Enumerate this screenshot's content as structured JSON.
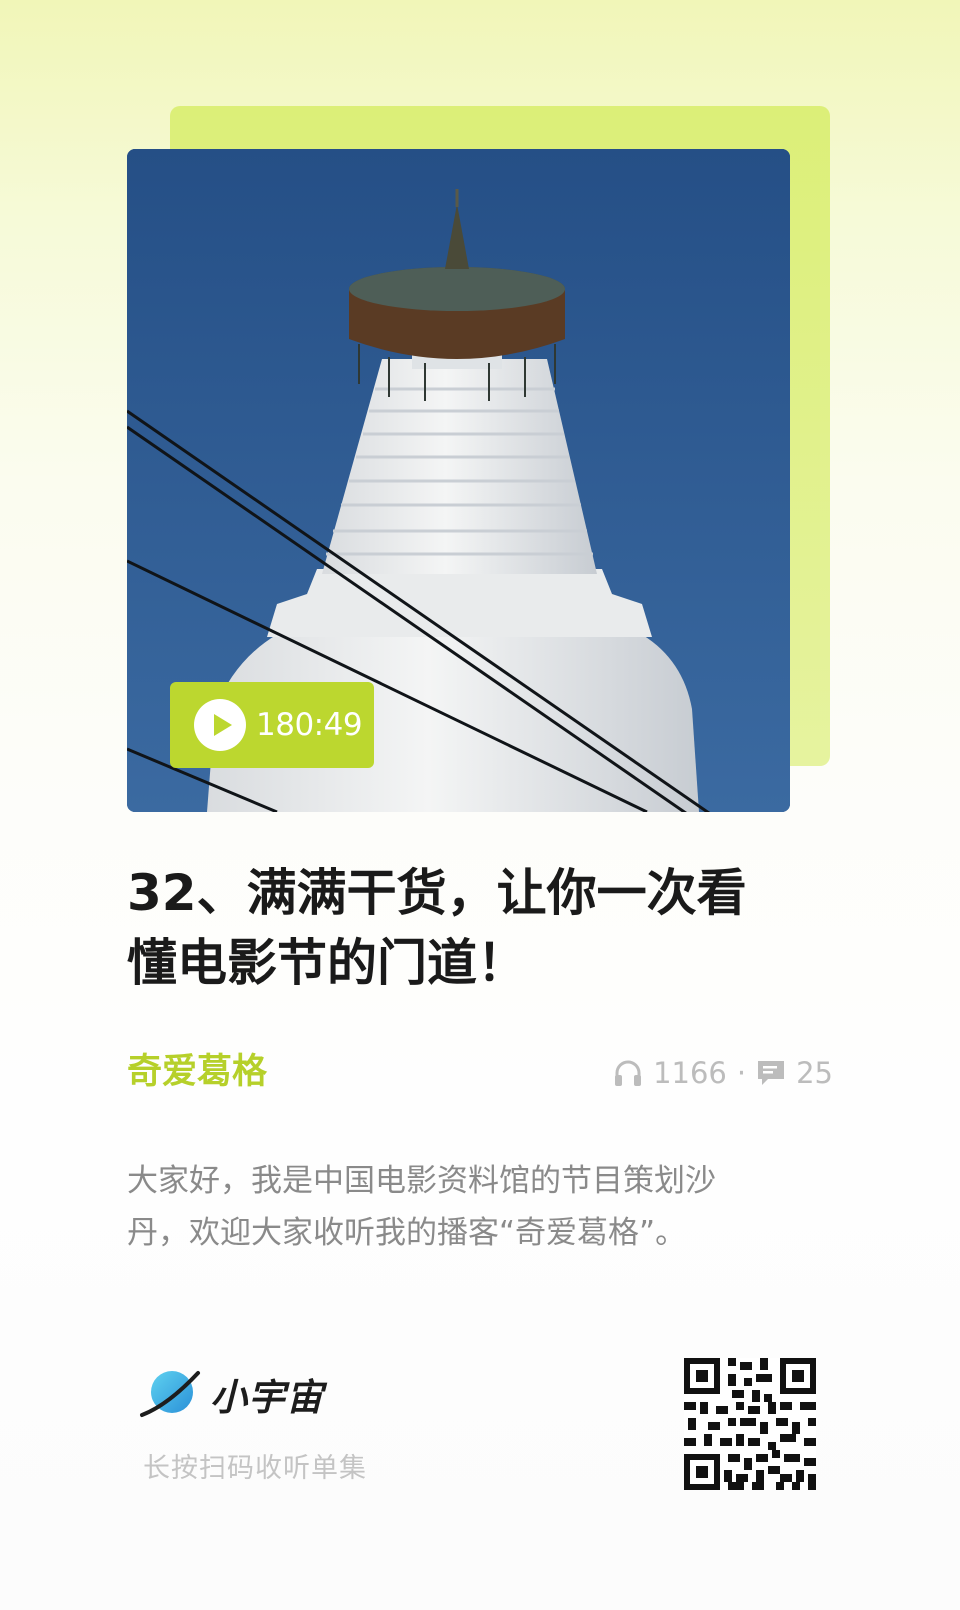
{
  "episode": {
    "duration": "180:49",
    "title_line1": "32、满满干货，让你一次看",
    "title_line2": "懂电影节的门道！",
    "podcast_name": "奇爱葛格",
    "plays": "1166",
    "separator": "·",
    "comments": "25",
    "description_line1": "大家好，我是中国电影资料馆的节目策划沙",
    "description_line2": "丹，欢迎大家收听我的播客“奇爱葛格”。"
  },
  "footer": {
    "brand_name": "小宇宙",
    "scan_hint": "长按扫码收听单集"
  },
  "icons": {
    "play": "play-icon",
    "plays": "headphones-icon",
    "comments": "comment-icon",
    "brand": "planet-logo-icon"
  },
  "colors": {
    "accent": "#bcd72f",
    "title": "#1a1a1a",
    "muted": "#8a8a8a"
  }
}
